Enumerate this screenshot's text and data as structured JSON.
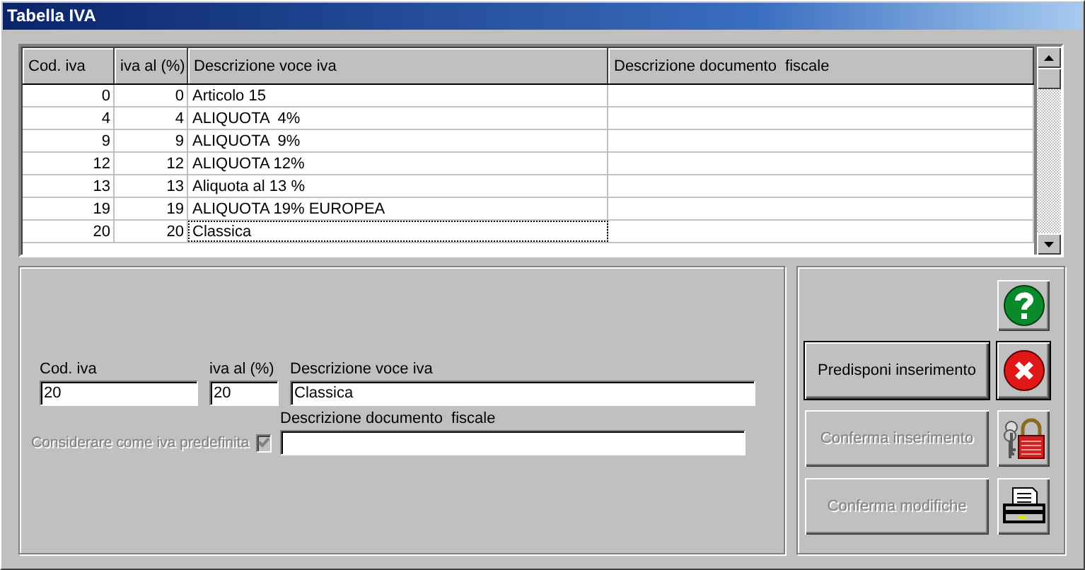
{
  "window": {
    "title": "Tabella IVA"
  },
  "table": {
    "columns": [
      "Cod. iva",
      "iva al (%)",
      "Descrizione voce iva",
      "Descrizione documento  fiscale"
    ],
    "rows": [
      {
        "cod": "0",
        "aliquota": "0",
        "descrizione": "Articolo 15",
        "selected": false
      },
      {
        "cod": "4",
        "aliquota": "4",
        "descrizione": "ALIQUOTA  4%",
        "selected": false
      },
      {
        "cod": "9",
        "aliquota": "9",
        "descrizione": "ALIQUOTA  9%",
        "selected": false
      },
      {
        "cod": "12",
        "aliquota": "12",
        "descrizione": "ALIQUOTA 12%",
        "selected": false
      },
      {
        "cod": "13",
        "aliquota": "13",
        "descrizione": "Aliquota al 13 %",
        "selected": false
      },
      {
        "cod": "19",
        "aliquota": "19",
        "descrizione": "ALIQUOTA 19% EUROPEA",
        "selected": false
      },
      {
        "cod": "20",
        "aliquota": "20",
        "descrizione": "Classica",
        "selected": true
      }
    ]
  },
  "form": {
    "fields": [
      {
        "label": "Cod. iva",
        "value": "20"
      },
      {
        "label": "iva al (%)",
        "value": "20"
      },
      {
        "label": "Descrizione voce iva",
        "value": "Classica"
      },
      {
        "label": "Descrizione documento  fiscale"
      }
    ],
    "checkbox": {
      "label": "Considerare come iva predefinita",
      "checked": true,
      "disabled": true
    }
  },
  "action_buttons": [
    {
      "label": "Predisponi inserimento",
      "disabled": false
    },
    {
      "label": "Conferma inserimento",
      "disabled": true
    },
    {
      "label": "Conferma modifiche",
      "disabled": true
    }
  ]
}
